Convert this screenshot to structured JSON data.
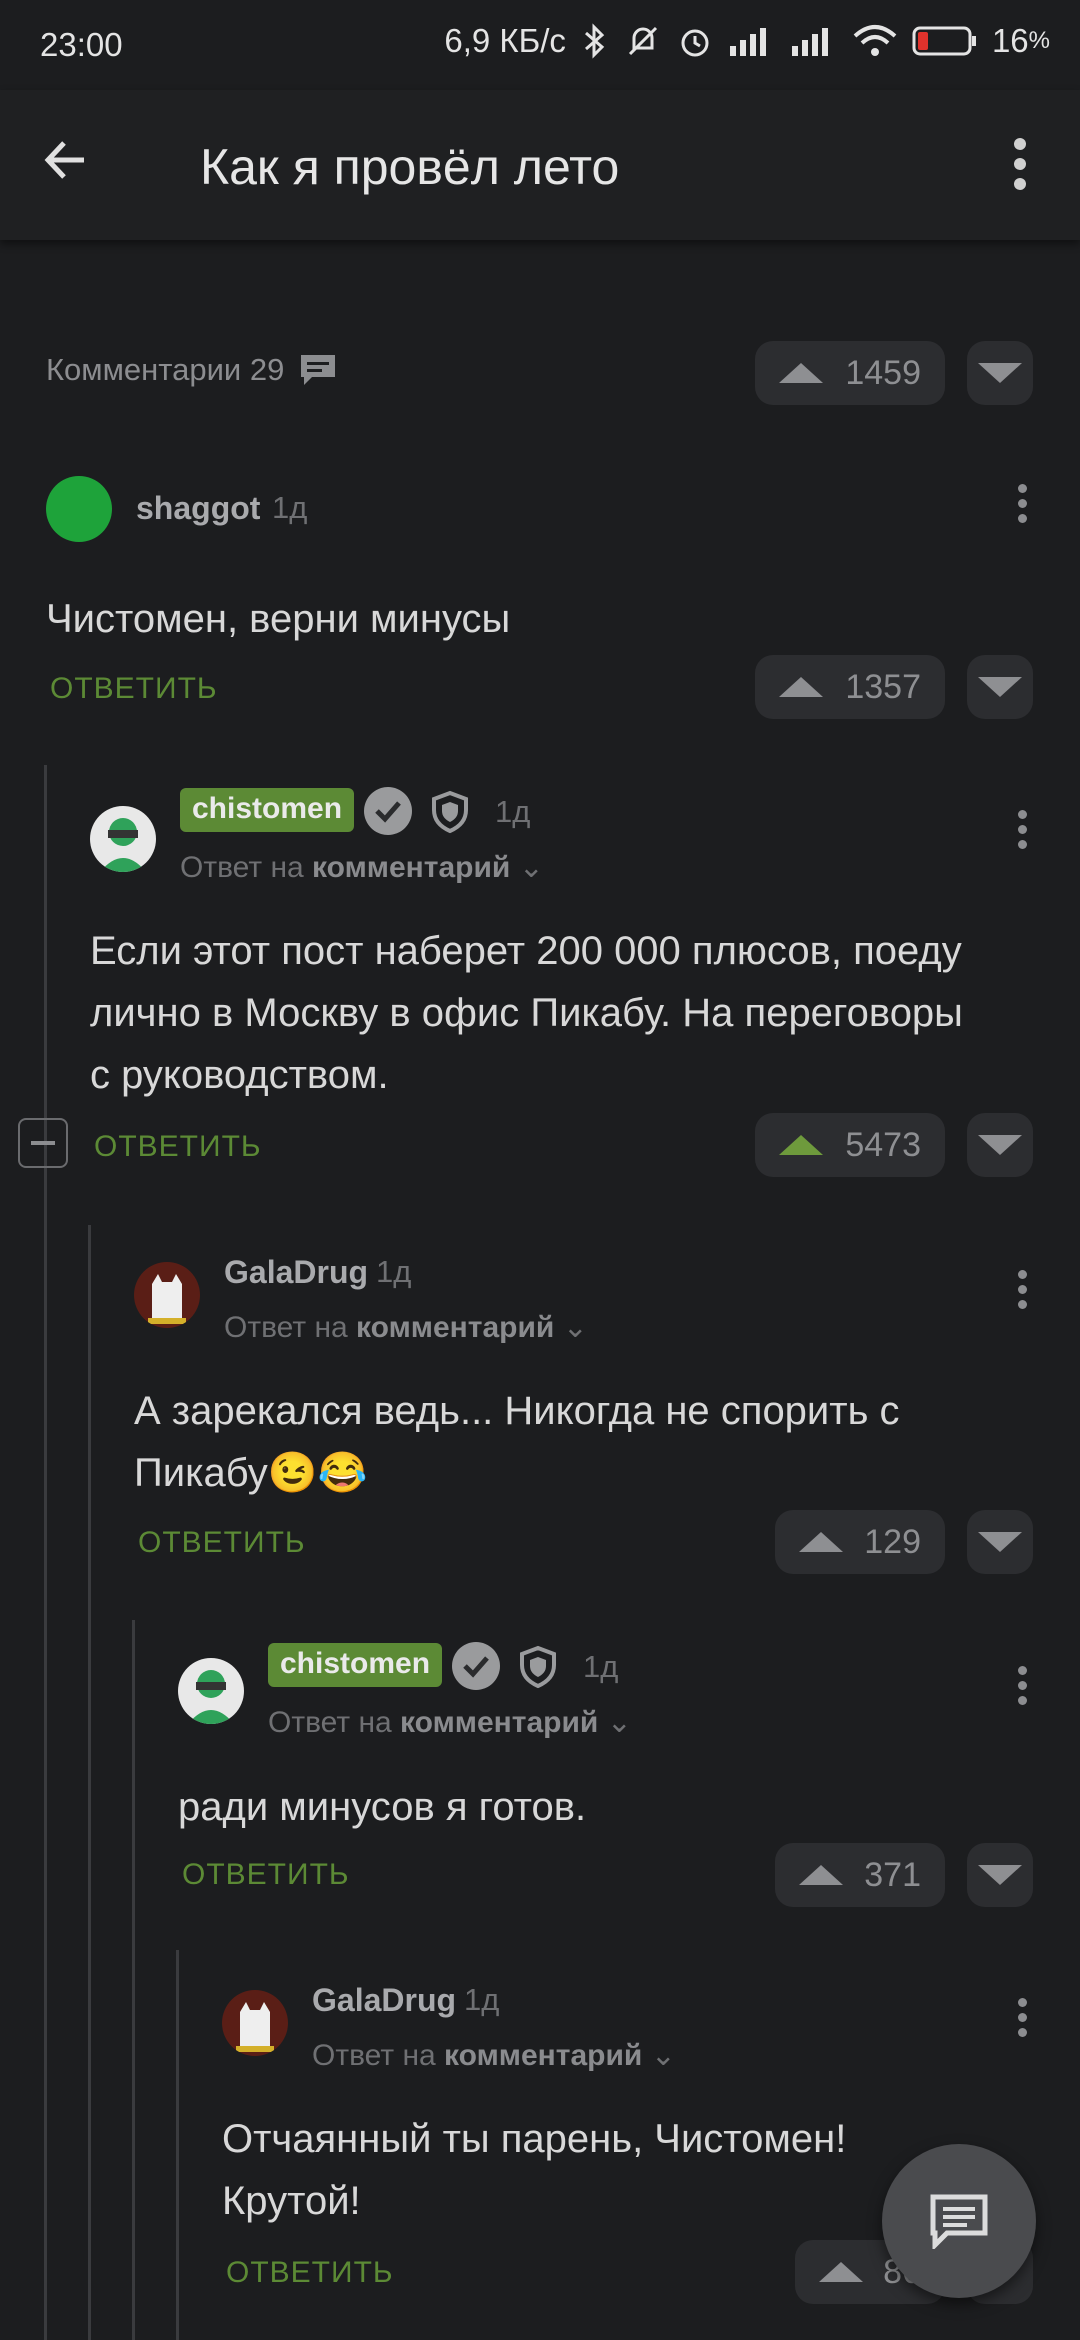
{
  "status": {
    "time": "23:00",
    "speed": "6,9 КБ/с",
    "battery": "16",
    "battery_unit": "%"
  },
  "appbar": {
    "title": "Как я провёл лето"
  },
  "comments": {
    "label": "Комментарии 29",
    "post_votes": "1459"
  },
  "reply_label": "ОТВЕТИТЬ",
  "reply_to_prefix": "Ответ на",
  "reply_to_target": "комментарий",
  "items": [
    {
      "author": "shaggot",
      "time": "1д",
      "text": "Чистомен, верни минусы",
      "votes": "1357"
    },
    {
      "author": "chistomen",
      "time": "1д",
      "text": "Если этот пост наберет 200 000 плюсов, поеду лично  в Москву в офис Пикабу. На переговоры с руководством.",
      "votes": "5473"
    },
    {
      "author": "GalaDrug",
      "time": "1д",
      "text": "А зарекался ведь... Никогда не спорить с Пикабу😉😂",
      "votes": "129"
    },
    {
      "author": "chistomen",
      "time": "1д",
      "text": "ради минусов я готов.",
      "votes": "371"
    },
    {
      "author": "GalaDrug",
      "time": "1д",
      "text": "Отчаянный ты парень, Чистомен! Крутой!",
      "votes": "86"
    }
  ],
  "icons": {
    "back": "arrow-left-icon",
    "menu": "more-vert-icon",
    "comments": "comment-bubble-icon",
    "fab": "new-comment-icon"
  },
  "colors": {
    "accent": "#5c8a35",
    "background": "#1c1d1f"
  }
}
